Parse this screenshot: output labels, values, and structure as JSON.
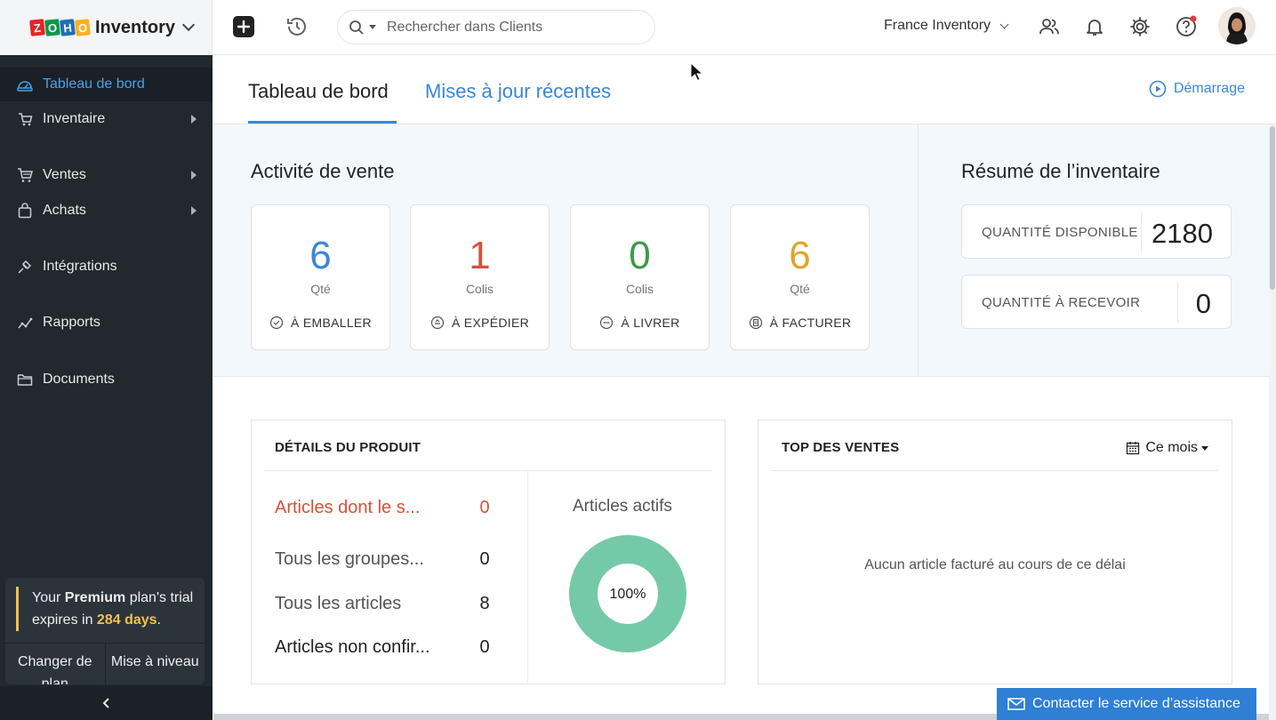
{
  "header": {
    "brand_letters": [
      "Z",
      "O",
      "H",
      "O"
    ],
    "brand_colors": [
      "#e42527",
      "#089949",
      "#226db4",
      "#f9b21d"
    ],
    "app_name": "Inventory",
    "search_placeholder": "Rechercher dans Clients",
    "organization": "France Inventory",
    "icons": [
      "plus-icon",
      "history-icon",
      "search-icon",
      "users-icon",
      "bell-icon",
      "gear-icon",
      "help-icon"
    ]
  },
  "sidebar": {
    "items": [
      {
        "label": "Tableau de bord",
        "icon": "dashboard-icon",
        "active": true
      },
      {
        "label": "Inventaire",
        "icon": "inventory-icon",
        "has_submenu": true
      },
      {
        "label": "Ventes",
        "icon": "cart-icon",
        "has_submenu": true
      },
      {
        "label": "Achats",
        "icon": "bag-icon",
        "has_submenu": true
      },
      {
        "label": "Intégrations",
        "icon": "integrations-icon"
      },
      {
        "label": "Rapports",
        "icon": "reports-icon"
      },
      {
        "label": "Documents",
        "icon": "folder-icon"
      }
    ],
    "trial": {
      "prefix": "Your ",
      "plan": "Premium",
      "middle": " plan's trial expires in ",
      "days": "284 days",
      "suffix": ".",
      "change_plan": "Changer de plan",
      "upgrade": "Mise à niveau"
    }
  },
  "tabs": {
    "dashboard": "Tableau de bord",
    "updates": "Mises à jour récentes",
    "getting_started": "Démarrage"
  },
  "sales_activity": {
    "title": "Activité de vente",
    "cards": [
      {
        "value": "6",
        "unit": "Qté",
        "label": "À EMBALLER",
        "color": "#3a86d8"
      },
      {
        "value": "1",
        "unit": "Colis",
        "label": "À EXPÉDIER",
        "color": "#d4523a"
      },
      {
        "value": "0",
        "unit": "Colis",
        "label": "À LIVRER",
        "color": "#3c9a4a"
      },
      {
        "value": "6",
        "unit": "Qté",
        "label": "À FACTURER",
        "color": "#d9a72c"
      }
    ]
  },
  "inventory_summary": {
    "title": "Résumé de l’inventaire",
    "available_label": "QUANTITÉ DISPONIBLE",
    "available_value": "2180",
    "to_receive_label": "QUANTITÉ À RECEVOIR",
    "to_receive_value": "0"
  },
  "product_details": {
    "title": "DÉTAILS DU PRODUIT",
    "rows": [
      {
        "label": "Articles dont le s...",
        "value": "0",
        "highlight": true
      },
      {
        "label": "Tous les groupes...",
        "value": "0"
      },
      {
        "label": "Tous les articles",
        "value": "8"
      },
      {
        "label": "Articles non confir...",
        "value": "0"
      }
    ],
    "active_title": "Articles actifs",
    "active_percent": "100%",
    "donut_color": "#74c9a9",
    "alert_color": "#d4523a"
  },
  "top_sales": {
    "title": "TOP DES VENTES",
    "period": "Ce mois",
    "empty_message": "Aucun article facturé au cours de ce délai"
  },
  "support_button": "Contacter le service d’assistance"
}
